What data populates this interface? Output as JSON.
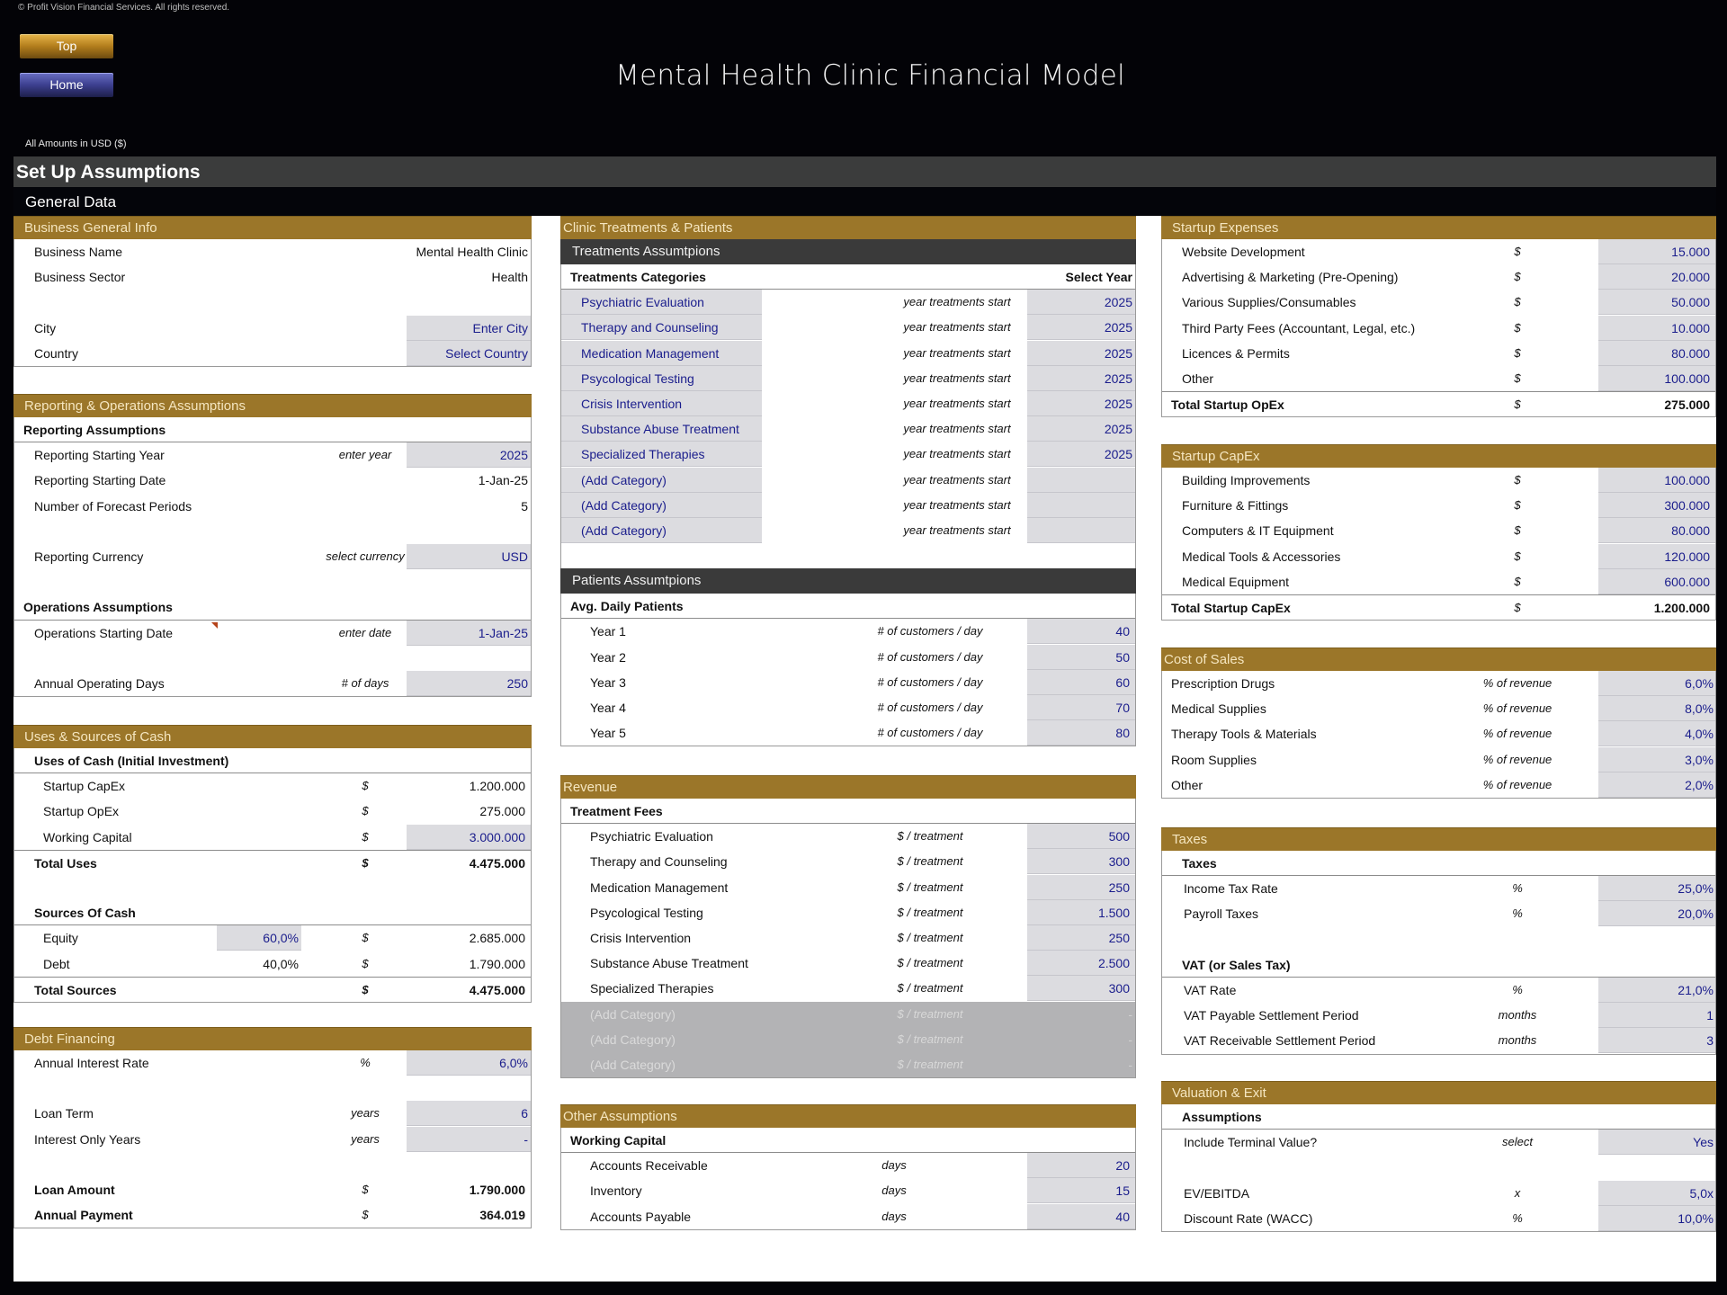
{
  "header": {
    "copyright": "© Profit Vision Financial Services. All rights reserved.",
    "top_button": "Top",
    "home_button": "Home",
    "title": "Mental Health Clinic Financial Model",
    "amounts_note": "All Amounts in  USD ($)",
    "section_title": "Set Up Assumptions",
    "subsection_title": "General Data"
  },
  "colors": {
    "section_gold": "#9b7629",
    "input_blue": "#1a1d8c",
    "input_fill": "#dcdce0",
    "dark_header": "#3a3a3a"
  },
  "business_info": {
    "title": "Business General Info",
    "rows": [
      {
        "label": "Business Name",
        "value": "Mental Health Clinic"
      },
      {
        "label": "Business Sector",
        "value": "Health"
      },
      {
        "label": "City",
        "value": "Enter City"
      },
      {
        "label": "Country",
        "value": "Select Country"
      }
    ]
  },
  "reporting_ops": {
    "title": "Reporting & Operations Assumptions",
    "reporting_header": "Reporting Assumptions",
    "reporting_rows": [
      {
        "label": "Reporting Starting Year",
        "unit": "enter year",
        "value": "2025"
      },
      {
        "label": "Reporting Starting Date",
        "unit": "",
        "value": "1-Jan-25"
      },
      {
        "label": "Number of Forecast Periods",
        "unit": "",
        "value": "5"
      },
      {
        "label": "Reporting Currency",
        "unit": "select currency",
        "value": "USD"
      }
    ],
    "operations_header": "Operations Assumptions",
    "operations_rows": [
      {
        "label": "Operations Starting Date",
        "unit": "enter date",
        "value": "1-Jan-25"
      },
      {
        "label": "Annual Operating Days",
        "unit": "# of days",
        "value": "250"
      }
    ]
  },
  "uses_sources": {
    "title": "Uses & Sources of Cash",
    "uses_header": "Uses of Cash (Initial Investment)",
    "uses_rows": [
      {
        "label": "Startup CapEx",
        "unit": "$",
        "value": "1.200.000"
      },
      {
        "label": "Startup OpEx",
        "unit": "$",
        "value": "275.000"
      },
      {
        "label": "Working Capital",
        "unit": "$",
        "value": "3.000.000"
      }
    ],
    "total_uses": {
      "label": "Total Uses",
      "unit": "$",
      "value": "4.475.000"
    },
    "sources_header": "Sources Of Cash",
    "sources_rows": [
      {
        "label": "Equity",
        "pct": "60,0%",
        "unit": "$",
        "value": "2.685.000"
      },
      {
        "label": "Debt",
        "pct": "40,0%",
        "unit": "$",
        "value": "1.790.000"
      }
    ],
    "total_sources": {
      "label": "Total Sources",
      "unit": "$",
      "value": "4.475.000"
    }
  },
  "debt_financing": {
    "title": "Debt Financing",
    "rows": [
      {
        "label": "Annual Interest Rate",
        "unit": "%",
        "value": "6,0%"
      },
      {
        "label": "Loan Term",
        "unit": "years",
        "value": "6"
      },
      {
        "label": "Interest Only Years",
        "unit": "years",
        "value": "-"
      },
      {
        "label": "Loan Amount",
        "unit": "$",
        "value": "1.790.000"
      },
      {
        "label": "Annual Payment",
        "unit": "$",
        "value": "364.019"
      }
    ]
  },
  "treatments": {
    "title": "Clinic Treatments & Patients",
    "sub_title": "Treatments Assumtpions",
    "col_category": "Treatments Categories",
    "col_year": "Select Year",
    "unit": "year treatments start",
    "rows": [
      {
        "category": "Psychiatric Evaluation",
        "year": "2025"
      },
      {
        "category": "Therapy and Counseling",
        "year": "2025"
      },
      {
        "category": "Medication Management",
        "year": "2025"
      },
      {
        "category": "Psycological Testing",
        "year": "2025"
      },
      {
        "category": "Crisis Intervention",
        "year": "2025"
      },
      {
        "category": "Substance Abuse Treatment",
        "year": "2025"
      },
      {
        "category": "Specialized Therapies",
        "year": "2025"
      },
      {
        "category": "(Add Category)",
        "year": ""
      },
      {
        "category": "(Add Category)",
        "year": ""
      },
      {
        "category": "(Add Category)",
        "year": ""
      }
    ]
  },
  "patients": {
    "sub_title": "Patients Assumtpions",
    "header": "Avg. Daily Patients",
    "unit": "# of customers / day",
    "rows": [
      {
        "label": "Year 1",
        "value": "40"
      },
      {
        "label": "Year 2",
        "value": "50"
      },
      {
        "label": "Year 3",
        "value": "60"
      },
      {
        "label": "Year 4",
        "value": "70"
      },
      {
        "label": "Year 5",
        "value": "80"
      }
    ]
  },
  "revenue": {
    "title": "Revenue",
    "header": "Treatment Fees",
    "unit": "$ / treatment",
    "rows": [
      {
        "label": "Psychiatric Evaluation",
        "value": "500"
      },
      {
        "label": "Therapy and Counseling",
        "value": "300"
      },
      {
        "label": "Medication Management",
        "value": "250"
      },
      {
        "label": "Psycological Testing",
        "value": "1.500"
      },
      {
        "label": "Crisis Intervention",
        "value": "250"
      },
      {
        "label": "Substance Abuse Treatment",
        "value": "2.500"
      },
      {
        "label": "Specialized Therapies",
        "value": "300"
      }
    ],
    "disabled_rows": [
      {
        "label": "(Add Category)",
        "value": "-"
      },
      {
        "label": "(Add Category)",
        "value": "-"
      },
      {
        "label": "(Add Category)",
        "value": "-"
      }
    ]
  },
  "other_assumptions": {
    "title": "Other Assumptions",
    "header": "Working Capital",
    "unit": "days",
    "rows": [
      {
        "label": "Accounts Receivable",
        "value": "20"
      },
      {
        "label": "Inventory",
        "value": "15"
      },
      {
        "label": "Accounts Payable",
        "value": "40"
      }
    ]
  },
  "startup_expenses": {
    "title": "Startup Expenses",
    "unit": "$",
    "rows": [
      {
        "label": "Website Development",
        "value": "15.000"
      },
      {
        "label": "Advertising & Marketing (Pre-Opening)",
        "value": "20.000"
      },
      {
        "label": "Various Supplies/Consumables",
        "value": "50.000"
      },
      {
        "label": "Third Party Fees (Accountant, Legal, etc.)",
        "value": "10.000"
      },
      {
        "label": "Licences & Permits",
        "value": "80.000"
      },
      {
        "label": "Other",
        "value": "100.000"
      }
    ],
    "total": {
      "label": "Total Startup OpEx",
      "value": "275.000"
    }
  },
  "startup_capex": {
    "title": "Startup CapEx",
    "unit": "$",
    "rows": [
      {
        "label": "Building Improvements",
        "value": "100.000"
      },
      {
        "label": "Furniture & Fittings",
        "value": "300.000"
      },
      {
        "label": "Computers & IT Equipment",
        "value": "80.000"
      },
      {
        "label": "Medical Tools & Accessories",
        "value": "120.000"
      },
      {
        "label": "Medical Equipment",
        "value": "600.000"
      }
    ],
    "total": {
      "label": "Total Startup CapEx",
      "value": "1.200.000"
    }
  },
  "cost_of_sales": {
    "title": "Cost of Sales",
    "unit": "% of revenue",
    "rows": [
      {
        "label": "Prescription Drugs",
        "value": "6,0%"
      },
      {
        "label": "Medical Supplies",
        "value": "8,0%"
      },
      {
        "label": "Therapy Tools & Materials",
        "value": "4,0%"
      },
      {
        "label": "Room Supplies",
        "value": "3,0%"
      },
      {
        "label": "Other",
        "value": "2,0%"
      }
    ]
  },
  "taxes": {
    "title": "Taxes",
    "taxes_header": "Taxes",
    "taxes_rows": [
      {
        "label": "Income Tax Rate",
        "unit": "%",
        "value": "25,0%"
      },
      {
        "label": "Payroll Taxes",
        "unit": "%",
        "value": "20,0%"
      }
    ],
    "vat_header": "VAT (or Sales Tax)",
    "vat_rows": [
      {
        "label": "VAT Rate",
        "unit": "%",
        "value": "21,0%"
      },
      {
        "label": "VAT Payable Settlement Period",
        "unit": "months",
        "value": "1"
      },
      {
        "label": "VAT Receivable Settlement Period",
        "unit": "months",
        "value": "3"
      }
    ]
  },
  "valuation": {
    "title": "Valuation & Exit",
    "header": "Assumptions",
    "rows": [
      {
        "label": "Include Terminal Value?",
        "unit": "select",
        "value": "Yes"
      },
      {
        "label": "EV/EBITDA",
        "unit": "x",
        "value": "5,0x"
      },
      {
        "label": "Discount Rate (WACC)",
        "unit": "%",
        "value": "10,0%"
      }
    ]
  }
}
